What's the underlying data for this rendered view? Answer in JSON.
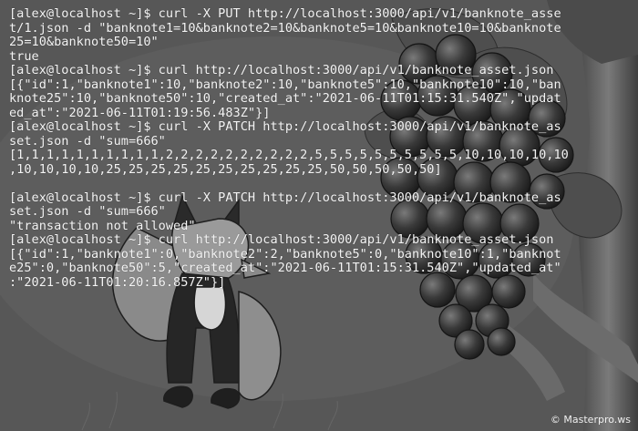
{
  "terminal": {
    "lines": [
      "[alex@localhost ~]$ curl -X PUT http://localhost:3000/api/v1/banknote_asse",
      "t/1.json -d \"banknote1=10&banknote2=10&banknote5=10&banknote10=10&banknote",
      "25=10&banknote50=10\"",
      "true",
      "[alex@localhost ~]$ curl http://localhost:3000/api/v1/banknote_asset.json",
      "[{\"id\":1,\"banknote1\":10,\"banknote2\":10,\"banknote5\":10,\"banknote10\":10,\"ban",
      "knote25\":10,\"banknote50\":10,\"created_at\":\"2021-06-11T01:15:31.540Z\",\"updat",
      "ed_at\":\"2021-06-11T01:19:56.483Z\"}]",
      "[alex@localhost ~]$ curl -X PATCH http://localhost:3000/api/v1/banknote_as",
      "set.json -d \"sum=666\"",
      "[1,1,1,1,1,1,1,1,1,1,2,2,2,2,2,2,2,2,2,2,5,5,5,5,5,5,5,5,5,5,10,10,10,10,10",
      ",10,10,10,10,25,25,25,25,25,25,25,25,25,25,50,50,50,50,50]",
      "",
      "[alex@localhost ~]$ curl -X PATCH http://localhost:3000/api/v1/banknote_as",
      "set.json -d \"sum=666\"",
      "\"transaction not allowed\"",
      "[alex@localhost ~]$ curl http://localhost:3000/api/v1/banknote_asset.json",
      "[{\"id\":1,\"banknote1\":0,\"banknote2\":2,\"banknote5\":0,\"banknote10\":1,\"banknot",
      "e25\":0,\"banknote50\":5,\"created_at\":\"2021-06-11T01:15:31.540Z\",\"updated_at\"",
      ":\"2021-06-11T01:20:16.857Z\"}]"
    ]
  },
  "watermark": {
    "text": "© Masterpro.ws"
  },
  "colors": {
    "background": "#575757",
    "text": "#f4f4f4"
  }
}
